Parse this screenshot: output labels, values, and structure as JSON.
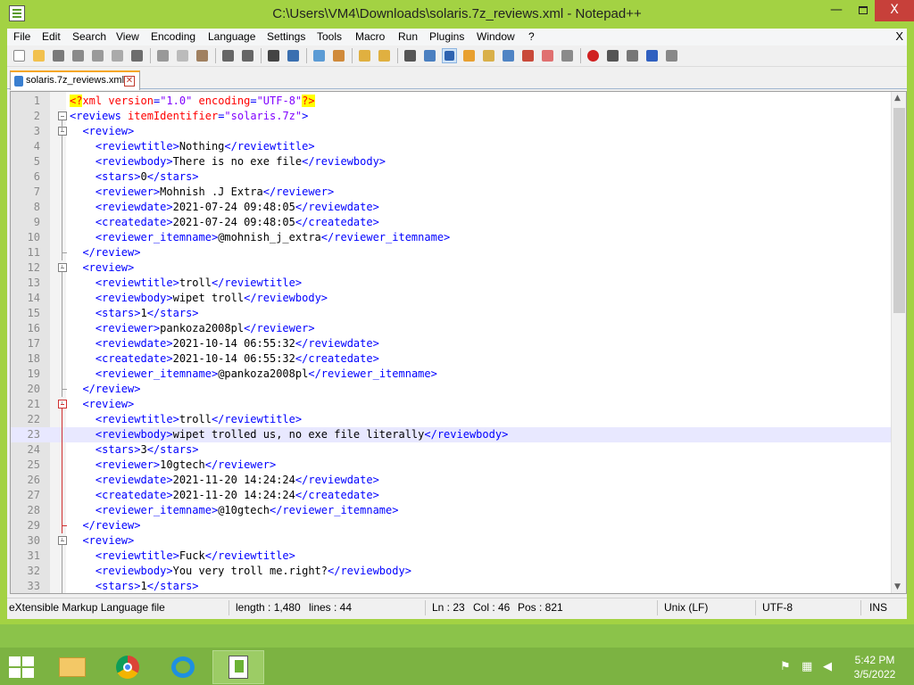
{
  "window": {
    "title": "C:\\Users\\VM4\\Downloads\\solaris.7z_reviews.xml - Notepad++",
    "close_glyph": "X",
    "min_glyph": "—"
  },
  "menu": {
    "items": [
      "File",
      "Edit",
      "Search",
      "View",
      "Encoding",
      "Language",
      "Settings",
      "Tools",
      "Macro",
      "Run",
      "Plugins",
      "Window",
      "?"
    ],
    "close_doc": "X"
  },
  "tab": {
    "label": "solaris.7z_reviews.xml",
    "close_glyph": "✕"
  },
  "editor": {
    "current_line": 23,
    "lines": [
      {
        "n": "1",
        "text": "<?xml version=\"1.0\" encoding=\"UTF-8\"?>"
      },
      {
        "n": "2",
        "text": "<reviews itemIdentifier=\"solaris.7z\">"
      },
      {
        "n": "3",
        "text": "  <review>"
      },
      {
        "n": "4",
        "text": "    <reviewtitle>Nothing</reviewtitle>"
      },
      {
        "n": "5",
        "text": "    <reviewbody>There is no exe file</reviewbody>"
      },
      {
        "n": "6",
        "text": "    <stars>0</stars>"
      },
      {
        "n": "7",
        "text": "    <reviewer>Mohnish .J Extra</reviewer>"
      },
      {
        "n": "8",
        "text": "    <reviewdate>2021-07-24 09:48:05</reviewdate>"
      },
      {
        "n": "9",
        "text": "    <createdate>2021-07-24 09:48:05</createdate>"
      },
      {
        "n": "10",
        "text": "    <reviewer_itemname>@mohnish_j_extra</reviewer_itemname>"
      },
      {
        "n": "11",
        "text": "  </review>"
      },
      {
        "n": "12",
        "text": "  <review>"
      },
      {
        "n": "13",
        "text": "    <reviewtitle>troll</reviewtitle>"
      },
      {
        "n": "14",
        "text": "    <reviewbody>wipet troll</reviewbody>"
      },
      {
        "n": "15",
        "text": "    <stars>1</stars>"
      },
      {
        "n": "16",
        "text": "    <reviewer>pankoza2008pl</reviewer>"
      },
      {
        "n": "17",
        "text": "    <reviewdate>2021-10-14 06:55:32</reviewdate>"
      },
      {
        "n": "18",
        "text": "    <createdate>2021-10-14 06:55:32</createdate>"
      },
      {
        "n": "19",
        "text": "    <reviewer_itemname>@pankoza2008pl</reviewer_itemname>"
      },
      {
        "n": "20",
        "text": "  </review>"
      },
      {
        "n": "21",
        "text": "  <review>"
      },
      {
        "n": "22",
        "text": "    <reviewtitle>troll</reviewtitle>"
      },
      {
        "n": "23",
        "text": "    <reviewbody>wipet trolled us, no exe file literally</reviewbody>"
      },
      {
        "n": "24",
        "text": "    <stars>3</stars>"
      },
      {
        "n": "25",
        "text": "    <reviewer>10gtech</reviewer>"
      },
      {
        "n": "26",
        "text": "    <reviewdate>2021-11-20 14:24:24</reviewdate>"
      },
      {
        "n": "27",
        "text": "    <createdate>2021-11-20 14:24:24</createdate>"
      },
      {
        "n": "28",
        "text": "    <reviewer_itemname>@10gtech</reviewer_itemname>"
      },
      {
        "n": "29",
        "text": "  </review>"
      },
      {
        "n": "30",
        "text": "  <review>"
      },
      {
        "n": "31",
        "text": "    <reviewtitle>Fuck</reviewtitle>"
      },
      {
        "n": "32",
        "text": "    <reviewbody>You very troll me.right?</reviewbody>"
      },
      {
        "n": "33",
        "text": "    <stars>1</stars>"
      }
    ]
  },
  "status": {
    "file_type": "eXtensible Markup Language file",
    "length": "length : 1,480",
    "lines": "lines : 44",
    "ln": "Ln : 23",
    "col": "Col : 46",
    "pos": "Pos : 821",
    "eol": "Unix (LF)",
    "encoding": "UTF-8",
    "mode": "INS"
  },
  "taskbar": {
    "time": "5:42 PM",
    "date": "3/5/2022",
    "apps": [
      "file-explorer",
      "chrome",
      "internet-explorer",
      "notepad-plus-plus"
    ]
  },
  "colors": {
    "tag": "#0000ff",
    "attr": "#ff0000",
    "value": "#8000ff",
    "text": "#000000",
    "accent": "#a3d243"
  }
}
